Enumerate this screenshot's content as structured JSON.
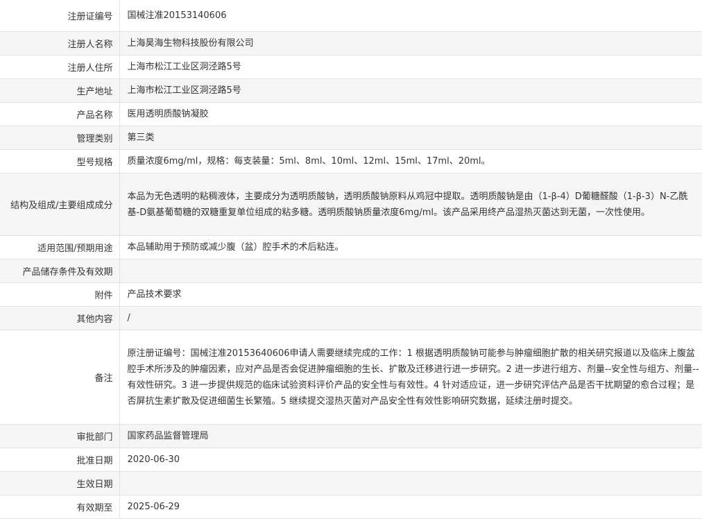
{
  "rows": [
    {
      "label": "注册证编号",
      "value": "国械注准20153140606"
    },
    {
      "label": "注册人名称",
      "value": "上海昊海生物科技股份有限公司"
    },
    {
      "label": "注册人住所",
      "value": "上海市松江工业区洞泾路5号"
    },
    {
      "label": "生产地址",
      "value": "上海市松江工业区洞泾路5号"
    },
    {
      "label": "产品名称",
      "value": "医用透明质酸钠凝胶"
    },
    {
      "label": "管理类别",
      "value": "第三类"
    },
    {
      "label": "型号规格",
      "value": "质量浓度6mg/ml，规格：每支装量：5ml、8ml、10ml、12ml、15ml、17ml、20ml。"
    },
    {
      "label": "结构及组成/主要组成成分",
      "value": "本品为无色透明的粘稠液体，主要成分为透明质酸钠，透明质酸钠原料从鸡冠中提取。透明质酸钠是由（1-β-4）D葡糖醛酸（1-β-3）N-乙酰基-D氨基葡萄糖的双糖重复单位组成的粘多糖。透明质酸钠质量浓度6mg/ml。该产品采用终产品湿热灭菌达到无菌，一次性使用。"
    },
    {
      "label": "适用范围/预期用途",
      "value": "本品辅助用于预防或减少腹（盆）腔手术的术后粘连。"
    },
    {
      "label": "产品储存条件及有效期",
      "value": ""
    },
    {
      "label": "附件",
      "value": "产品技术要求"
    },
    {
      "label": "其他内容",
      "value": "/"
    },
    {
      "label": "备注",
      "value": "原注册证编号：国械注准20153640606申请人需要继续完成的工作：1 根据透明质酸钠可能参与肿瘤细胞扩散的相关研究报道以及临床上腹盆腔手术所涉及的肿瘤因素，应对产品是否会促进肿瘤细胞的生长、扩散及迁移进行进一步研究。2 进一步进行组方、剂量--安全性与组方、剂量--有效性研究。3 进一步提供规范的临床试验资料评价产品的安全性与有效性。4 针对适应证，进一步研究评估产品是否干扰期望的愈合过程；是否屏抗生素扩散及促进细菌生长繁殖。5 继续提交湿热灭菌对产品安全性有效性影响研究数据，延续注册时提交。"
    },
    {
      "label": "审批部门",
      "value": "国家药品监督管理局"
    },
    {
      "label": "批准日期",
      "value": "2020-06-30"
    },
    {
      "label": "生效日期",
      "value": ""
    },
    {
      "label": "有效期至",
      "value": "2025-06-29"
    }
  ]
}
